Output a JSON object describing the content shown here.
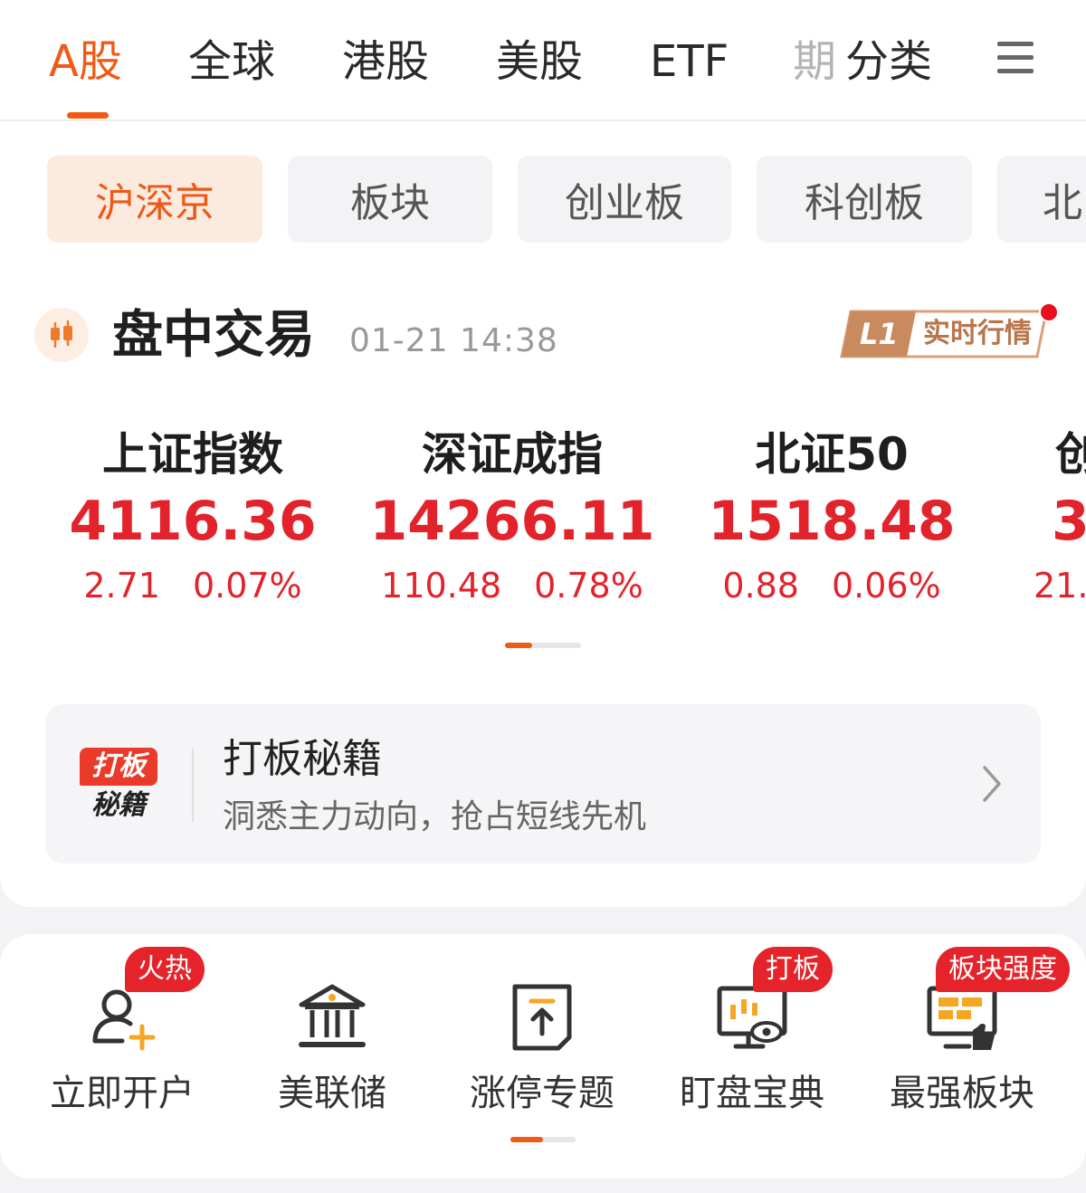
{
  "top_tabs": [
    {
      "label": "A股",
      "active": true
    },
    {
      "label": "全球"
    },
    {
      "label": "港股"
    },
    {
      "label": "美股"
    },
    {
      "label": "ETF"
    },
    {
      "label": "期"
    },
    {
      "label": "分类"
    }
  ],
  "market_chips": [
    {
      "label": "沪深京",
      "active": true
    },
    {
      "label": "板块"
    },
    {
      "label": "创业板"
    },
    {
      "label": "科创板"
    },
    {
      "label": "北"
    }
  ],
  "session": {
    "title": "盘中交易",
    "time": "01-21 14:38",
    "badge_level": "L1",
    "badge_text": "实时行情"
  },
  "indices": [
    {
      "name": "上证指数",
      "value": "4116.36",
      "change": "2.71",
      "pct": "0.07%"
    },
    {
      "name": "深证成指",
      "value": "14266.11",
      "change": "110.48",
      "pct": "0.78%"
    },
    {
      "name": "北证50",
      "value": "1518.48",
      "change": "0.88",
      "pct": "0.06%"
    },
    {
      "name": "创",
      "value": "3",
      "change": "21.",
      "pct": ""
    }
  ],
  "promo": {
    "logo_line1": "打板",
    "logo_line2": "秘籍",
    "title": "打板秘籍",
    "subtitle": "洞悉主力动向，抢占短线先机"
  },
  "shortcuts": [
    {
      "label": "立即开户",
      "badge": "火热",
      "icon": "add-user-icon"
    },
    {
      "label": "美联储",
      "badge": "",
      "icon": "bank-icon"
    },
    {
      "label": "涨停专题",
      "badge": "",
      "icon": "limit-up-icon"
    },
    {
      "label": "盯盘宝典",
      "badge": "打板",
      "icon": "monitor-watch-icon"
    },
    {
      "label": "最强板块",
      "badge": "板块强度",
      "icon": "sector-thumbs-up-icon"
    }
  ],
  "colors": {
    "accent": "#f05a14",
    "up_red": "#e2232b",
    "badge_red": "#e5232a"
  }
}
